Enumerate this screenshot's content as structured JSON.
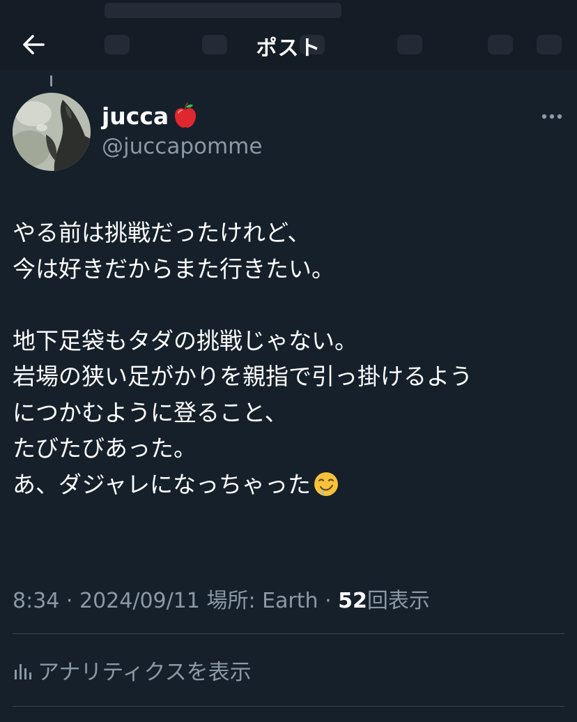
{
  "header": {
    "title": "ポスト",
    "back_icon": "back-arrow-icon"
  },
  "author": {
    "display_name": "jucca",
    "name_emoji": "red-apple-icon",
    "handle": "@juccapomme",
    "more_icon": "more-icon"
  },
  "tweet": {
    "lines": [
      "やる前は挑戦だったけれど、",
      "今は好きだからまた行きたい。",
      "",
      "地下足袋もタダの挑戦じゃない。",
      "岩場の狭い足がかりを親指で引っ掛けるよう",
      "につかむように登ること、",
      "たびたびあった。",
      "あ、ダジャレになっちゃった"
    ],
    "trailing_emoji": "drooling-face-icon"
  },
  "meta": {
    "time": "8:34",
    "sep1": " · ",
    "date": "2024/09/11",
    "location": " 場所: Earth",
    "sep2": " · ",
    "views_count": "52",
    "views_label": "回表示"
  },
  "analytics": {
    "icon": "analytics-bars-icon",
    "label": "アナリティクスを表示"
  },
  "colors": {
    "background": "#15202b",
    "text_primary": "#ffffff",
    "text_secondary": "#8b98a5",
    "divider": "#38444d"
  }
}
